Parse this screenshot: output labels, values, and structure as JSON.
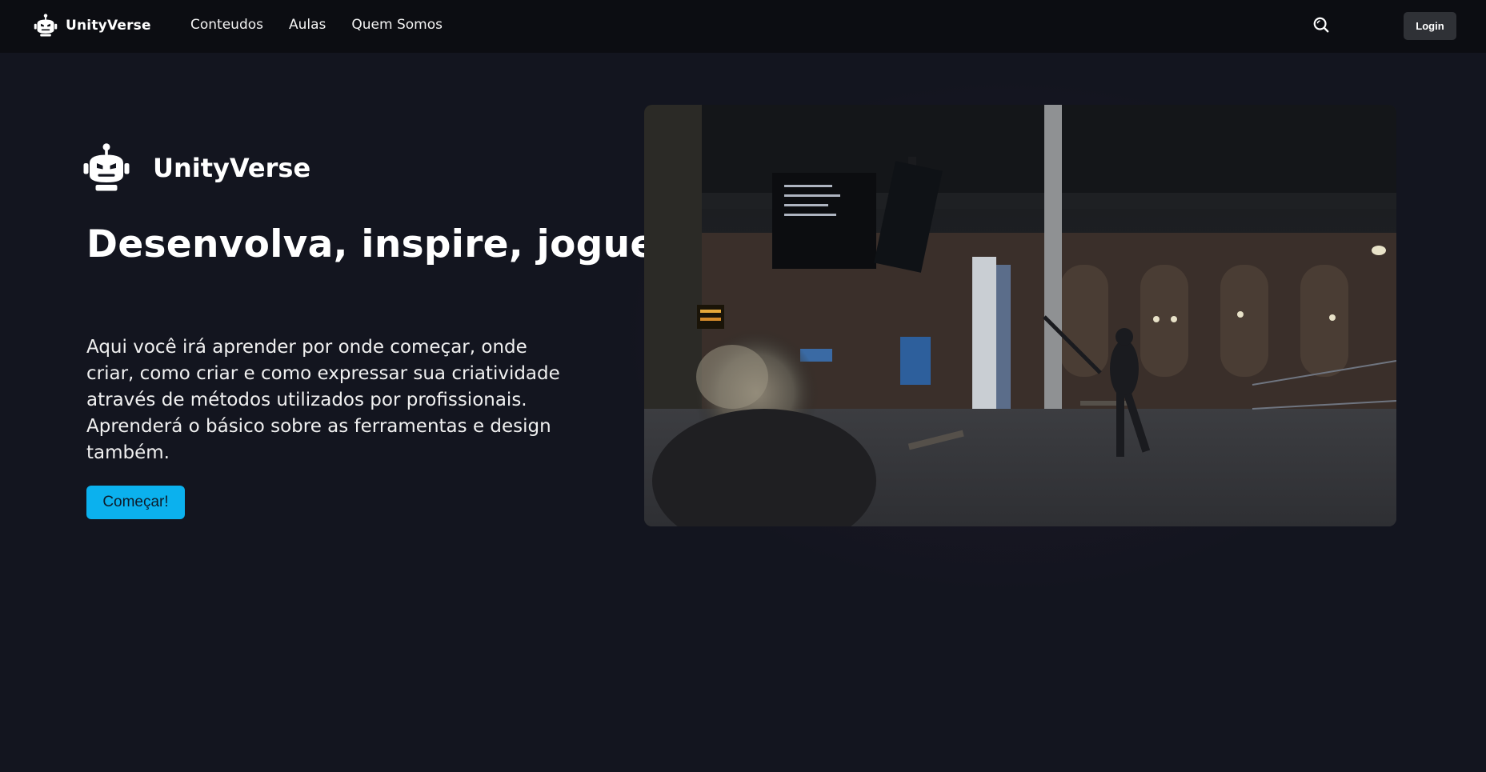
{
  "navbar": {
    "brand": "UnityVerse",
    "links": [
      "Conteudos",
      "Aulas",
      "Quem Somos"
    ],
    "login_label": "Login",
    "search_icon": "search-icon"
  },
  "hero": {
    "brand": "UnityVerse",
    "title": "Desenvolva, inspire, jogue.",
    "description": "Aqui você irá aprender por onde começar, onde criar, como criar e como expressar sua criatividade através de métodos utilizados por profissionais. Aprenderá o básico sobre as ferramentas e design também.",
    "cta_label": "Começar!"
  },
  "colors": {
    "background": "#13151f",
    "navbar": "#0c0d12",
    "accent": "#0bb1ee",
    "login_button": "#2f3136"
  },
  "icons": {
    "logo": "robot-head-icon",
    "search": "search-icon"
  }
}
